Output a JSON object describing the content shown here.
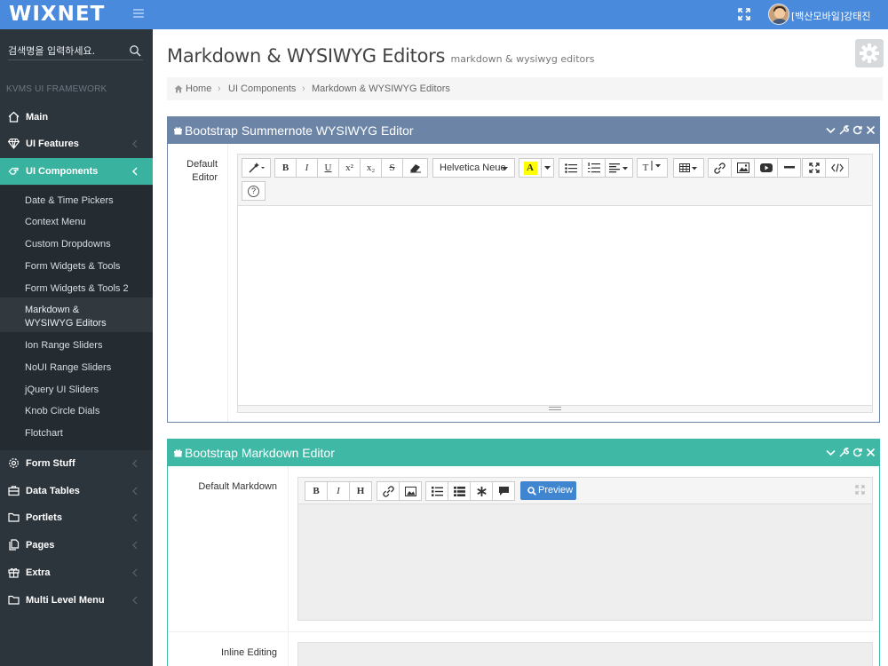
{
  "app": {
    "brand": "WIXNET",
    "user_name": "[백산모바일]강태진",
    "accent_color": "#4a8adc",
    "sidebar_active_color": "#39b3a0"
  },
  "sidebar": {
    "search_placeholder": "검색명을 입력하세요.",
    "heading": "KVMS UI FRAMEWORK",
    "items": [
      {
        "label": "Main",
        "icon": "home-icon",
        "active": false
      },
      {
        "label": "UI Features",
        "icon": "diamond-icon",
        "active": false
      },
      {
        "label": "UI Components",
        "icon": "hand-icon",
        "active": true
      },
      {
        "label": "Form Stuff",
        "icon": "gear-icon",
        "active": false
      },
      {
        "label": "Data Tables",
        "icon": "briefcase-icon",
        "active": false
      },
      {
        "label": "Portlets",
        "icon": "folder-icon",
        "active": false
      },
      {
        "label": "Pages",
        "icon": "files-icon",
        "active": false
      },
      {
        "label": "Extra",
        "icon": "gift-icon",
        "active": false
      },
      {
        "label": "Multi Level Menu",
        "icon": "folder-open-icon",
        "active": false
      }
    ],
    "submenu": [
      "Date & Time Pickers",
      "Context Menu",
      "Custom Dropdowns",
      "Form Widgets & Tools",
      "Form Widgets & Tools 2",
      "Markdown & WYSIWYG Editors",
      "Ion Range Sliders",
      "NoUI Range Sliders",
      "jQuery UI Sliders",
      "Knob Circle Dials",
      "Flotchart"
    ]
  },
  "page": {
    "title": "Markdown & WYSIWYG Editors",
    "subtitle": "markdown & wysiwyg editors",
    "breadcrumb": [
      "Home",
      "UI Components",
      "Markdown & WYSIWYG Editors"
    ]
  },
  "panels": {
    "summernote": {
      "title": "Bootstrap Summernote WYSIWYG Editor",
      "label": "Default Editor",
      "header_color": "#6c85a7",
      "font_name": "Helvetica Neue",
      "toolbar": {
        "bold": "B",
        "italic": "I",
        "underline": "U",
        "superscript": "x²",
        "subscript": "x₂",
        "strike": "S",
        "fontcolor": "A",
        "fontsize": "T",
        "help": "?"
      }
    },
    "markdown": {
      "title": "Bootstrap Markdown Editor",
      "label": "Default Markdown",
      "inline_label": "Inline Editing",
      "header_color": "#3fb8a5",
      "toolbar": {
        "bold": "B",
        "italic": "I",
        "heading": "H",
        "preview": "Preview"
      }
    }
  }
}
